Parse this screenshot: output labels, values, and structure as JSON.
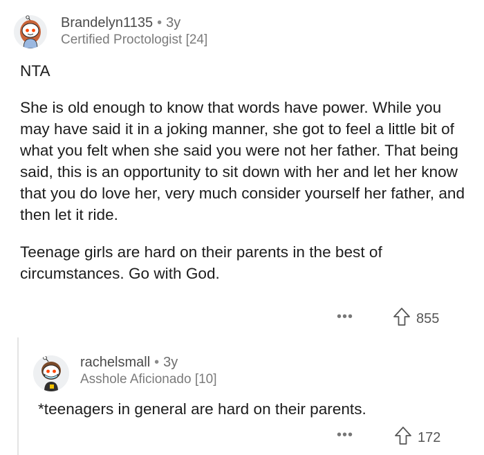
{
  "comments": [
    {
      "username": "Brandelyn1135",
      "separator": "•",
      "age": "3y",
      "flair": "Certified Proctologist [24]",
      "paragraphs": [
        "NTA",
        "She is old enough to know that words have power. While you may have said it in a joking manner, she got to feel a little bit of what you felt when she said you were not her father. That being said, this is an opportunity to sit down with her and let her know that you do love her, very much consider yourself her father, and then let it ride.",
        "Teenage girls are hard on their parents in the best of circumstances. Go with God."
      ],
      "more_label": "•••",
      "upvote_icon": "upvote-arrow-icon",
      "score": "855"
    },
    {
      "username": "rachelsmall",
      "separator": "•",
      "age": "3y",
      "flair": "Asshole Aficionado [10]",
      "paragraphs": [
        "*teenagers in general are hard on their parents."
      ],
      "more_label": "•••",
      "upvote_icon": "upvote-arrow-icon",
      "score": "172"
    }
  ],
  "colors": {
    "text": "#1c1c1c",
    "meta": "#7b7b7b",
    "avatar_bg": "#eef0f2",
    "accent_orange": "#ff4500"
  }
}
